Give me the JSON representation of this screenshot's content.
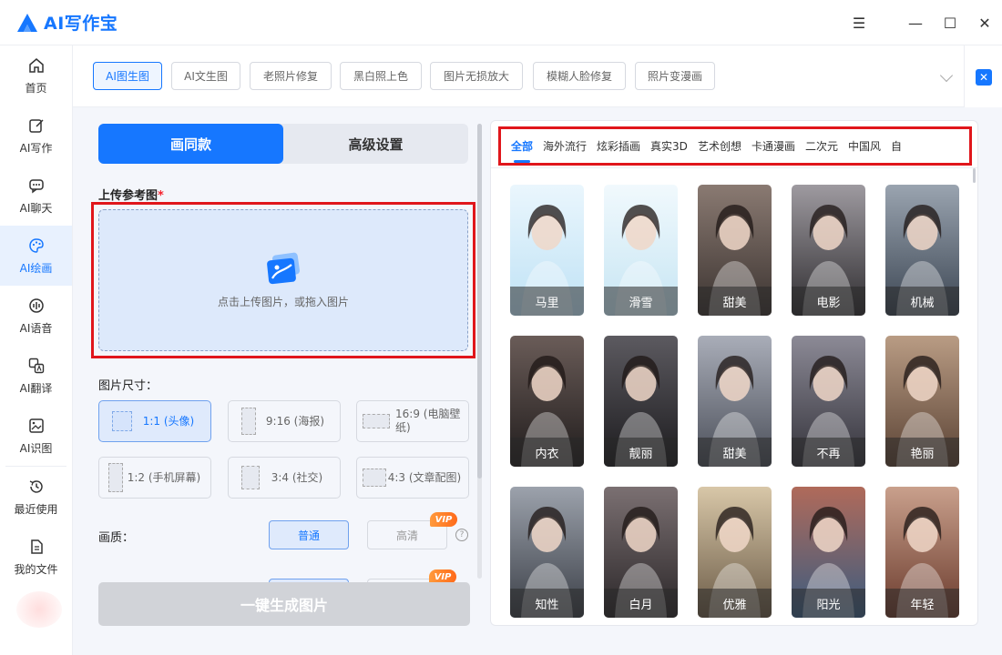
{
  "app": {
    "title": "AI写作宝"
  },
  "window": {
    "menu_glyph": "☰",
    "min_glyph": "—",
    "max_glyph": "☐",
    "close_glyph": "✕"
  },
  "sidebar": {
    "items": [
      {
        "label": "首页",
        "icon": "home-icon"
      },
      {
        "label": "AI写作",
        "icon": "write-icon"
      },
      {
        "label": "AI聊天",
        "icon": "chat-icon"
      },
      {
        "label": "AI绘画",
        "icon": "palette-icon",
        "active": true
      },
      {
        "label": "AI语音",
        "icon": "voice-icon"
      },
      {
        "label": "AI翻译",
        "icon": "translate-icon"
      },
      {
        "label": "AI识图",
        "icon": "image-recognition-icon"
      },
      {
        "label": "最近使用",
        "icon": "history-icon"
      },
      {
        "label": "我的文件",
        "icon": "file-icon"
      }
    ]
  },
  "tools": {
    "tabs": [
      "AI图生图",
      "AI文生图",
      "老照片修复",
      "黑白照上色",
      "图片无损放大",
      "模糊人脸修复",
      "照片变漫画"
    ],
    "active": "AI图生图",
    "close_glyph": "✕"
  },
  "left": {
    "mode_tabs": [
      "画同款",
      "高级设置"
    ],
    "upload_label": "上传参考图",
    "required_mark": "*",
    "upload_hint": "点击上传图片，或拖入图片",
    "size_label": "图片尺寸：",
    "sizes": [
      {
        "label": "1:1 (头像)",
        "active": true
      },
      {
        "label": "9:16 (海报)"
      },
      {
        "label": "16:9 (电脑壁纸)"
      },
      {
        "label": "1:2 (手机屏幕)"
      },
      {
        "label": "3:4 (社交)"
      },
      {
        "label": "4:3 (文章配图)"
      }
    ],
    "quality_label": "画质：",
    "quality": {
      "normal": "普通",
      "hd": "高清"
    },
    "vip_text": "VIP",
    "help_glyph": "?",
    "generate": "一键生成图片"
  },
  "right": {
    "categories": [
      "全部",
      "海外流行",
      "炫彩插画",
      "真实3D",
      "艺术创想",
      "卡通漫画",
      "二次元",
      "中国风",
      "自"
    ],
    "active_category": "全部",
    "styles": [
      {
        "label": "马里",
        "bg1": "#bfe2f5",
        "bg2": "#eaf6fd"
      },
      {
        "label": "滑雪",
        "bg1": "#c6e5f3",
        "bg2": "#f1f9fd"
      },
      {
        "label": "甜美",
        "bg1": "#3b3330",
        "bg2": "#8a7a72"
      },
      {
        "label": "电影",
        "bg1": "#2f2d30",
        "bg2": "#9e9aa0"
      },
      {
        "label": "机械",
        "bg1": "#3b4552",
        "bg2": "#9aa4b0"
      },
      {
        "label": "内衣",
        "bg1": "#201c1c",
        "bg2": "#6a5c58"
      },
      {
        "label": "靓丽",
        "bg1": "#1c1b1e",
        "bg2": "#5c5a60"
      },
      {
        "label": "甜美",
        "bg1": "#4a4e58",
        "bg2": "#a9adb8"
      },
      {
        "label": "不再",
        "bg1": "#33323a",
        "bg2": "#8c8a96"
      },
      {
        "label": "艳丽",
        "bg1": "#5a4234",
        "bg2": "#b99c84"
      },
      {
        "label": "知性",
        "bg1": "#3a3e46",
        "bg2": "#9ca2ac"
      },
      {
        "label": "白月",
        "bg1": "#2a2628",
        "bg2": "#7b7072"
      },
      {
        "label": "优雅",
        "bg1": "#6a5a46",
        "bg2": "#d8c7a8"
      },
      {
        "label": "阳光",
        "bg1": "#3a5c80",
        "bg2": "#b06a5a"
      },
      {
        "label": "年轻",
        "bg1": "#6a3a2c",
        "bg2": "#c9a08c"
      }
    ]
  }
}
